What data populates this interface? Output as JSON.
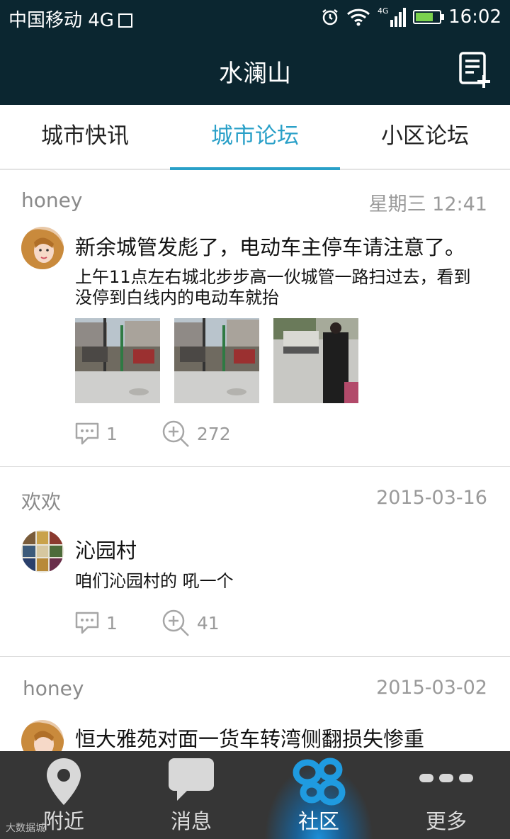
{
  "status_bar": {
    "carrier": "中国移动 4G",
    "network": "4G",
    "time": "16:02",
    "battery_level": 0.75
  },
  "header": {
    "title": "水澜山",
    "compose_icon": "compose-icon"
  },
  "tabs": [
    {
      "label": "城市快讯",
      "active": false
    },
    {
      "label": "城市论坛",
      "active": true
    },
    {
      "label": "小区论坛",
      "active": false
    }
  ],
  "posts": [
    {
      "author": "honey",
      "date": "星期三  12:41",
      "title": "新余城管发彪了，电动车主停车请注意了。",
      "body": "上午11点左右城北步步高一伙城管一路扫过去，看到没停到白线内的电动车就抬",
      "image_count": 3,
      "comments": "1",
      "views": "272"
    },
    {
      "author": "欢欢",
      "date": "2015-03-16",
      "title": "沁园村",
      "body": "咱们沁园村的 吼一个",
      "comments": "1",
      "views": "41"
    },
    {
      "author": "honey",
      "date": "2015-03-02",
      "title": "恒大雅苑对面一货车转湾侧翻损失惨重"
    }
  ],
  "nav": [
    {
      "label": "附近",
      "icon": "location-pin-icon"
    },
    {
      "label": "消息",
      "icon": "chat-bubble-icon"
    },
    {
      "label": "社区",
      "icon": "community-butterfly-icon",
      "active": true
    },
    {
      "label": "更多",
      "icon": "more-dots-icon"
    }
  ],
  "watermark": "大数据城"
}
